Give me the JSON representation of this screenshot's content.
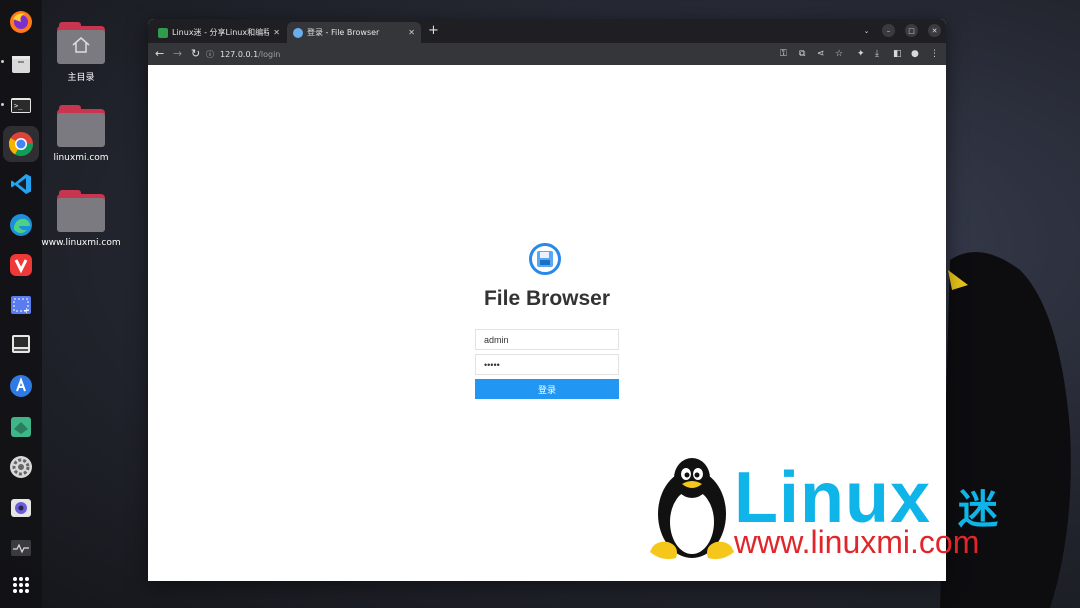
{
  "dock": {
    "items": [
      "firefox",
      "files",
      "terminal",
      "chrome",
      "vscode",
      "edge",
      "vivaldi",
      "screenshot",
      "disk-manager",
      "app-store",
      "maps",
      "settings",
      "camera",
      "system-monitor",
      "app-grid"
    ]
  },
  "desktop": {
    "icons": [
      {
        "label": "主目录"
      },
      {
        "label": "linuxmi.com"
      },
      {
        "label": "www.linuxmi.com"
      }
    ]
  },
  "browser": {
    "tabs": [
      {
        "title": "Linux迷 - 分享Linux和编程"
      },
      {
        "title": "登录 - File Browser"
      }
    ],
    "url_host": "127.0.0.1",
    "url_path": "/login"
  },
  "login": {
    "app_name": "File Browser",
    "username_value": "admin",
    "password_value": "•••••",
    "submit_label": "登录"
  },
  "branding": {
    "word": "Linux",
    "mi": "迷",
    "url": "www.linuxmi.com"
  },
  "colors": {
    "accent": "#2196f3",
    "brand_blue": "#0fb4e8",
    "brand_red": "#e0262a",
    "folder": "#c8354f"
  }
}
